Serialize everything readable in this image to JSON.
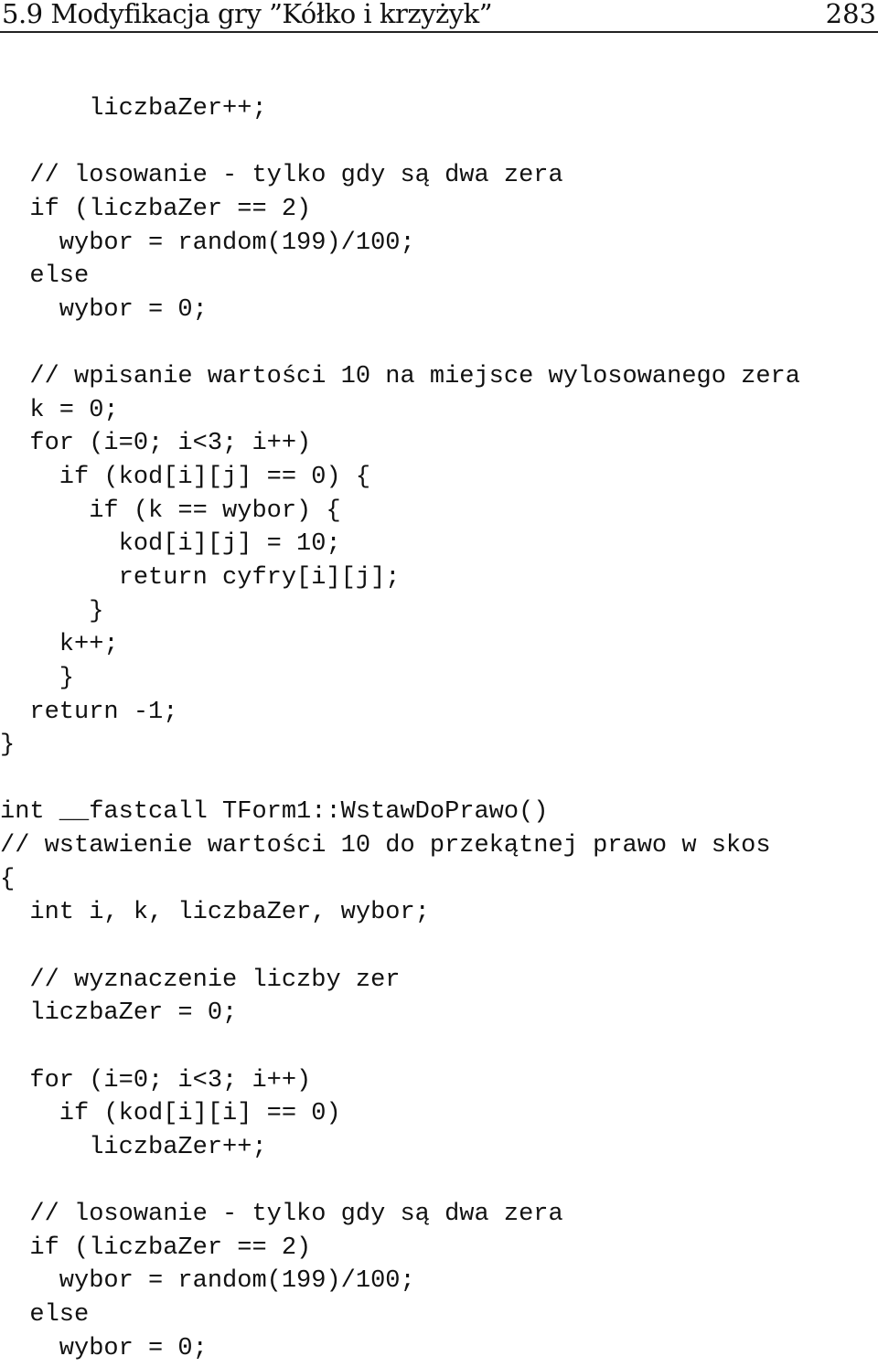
{
  "header": {
    "title": "5.9 Modyfikacja gry ”Kółko i krzyżyk”",
    "page_number": "283"
  },
  "code_lines": [
    "      liczbaZer++;",
    "",
    "  // losowanie - tylko gdy są dwa zera",
    "  if (liczbaZer == 2)",
    "    wybor = random(199)/100;",
    "  else",
    "    wybor = 0;",
    "",
    "  // wpisanie wartości 10 na miejsce wylosowanego zera",
    "  k = 0;",
    "  for (i=0; i<3; i++)",
    "    if (kod[i][j] == 0) {",
    "      if (k == wybor) {",
    "        kod[i][j] = 10;",
    "        return cyfry[i][j];",
    "      }",
    "    k++;",
    "    }",
    "  return -1;",
    "}",
    "",
    "int __fastcall TForm1::WstawDoPrawo()",
    "// wstawienie wartości 10 do przekątnej prawo w skos",
    "{",
    "  int i, k, liczbaZer, wybor;",
    "",
    "  // wyznaczenie liczby zer",
    "  liczbaZer = 0;",
    "",
    "  for (i=0; i<3; i++)",
    "    if (kod[i][i] == 0)",
    "      liczbaZer++;",
    "",
    "  // losowanie - tylko gdy są dwa zera",
    "  if (liczbaZer == 2)",
    "    wybor = random(199)/100;",
    "  else",
    "    wybor = 0;"
  ]
}
